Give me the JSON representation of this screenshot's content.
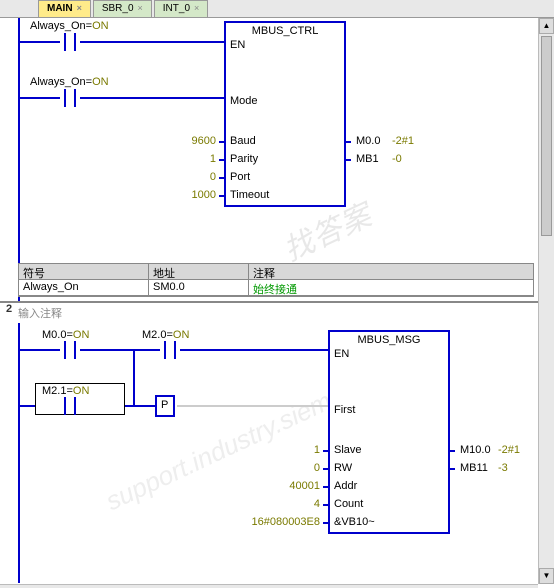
{
  "tabs": {
    "main": "MAIN",
    "sbr0": "SBR_0",
    "int0": "INT_0"
  },
  "net1": {
    "contact1": "Always_On=",
    "contact1_state": "ON",
    "contact2": "Always_On=",
    "contact2_state": "ON",
    "box": {
      "title": "MBUS_CTRL",
      "en": "EN",
      "mode": "Mode",
      "baud_lbl": "Baud",
      "baud_val": "9600",
      "baud_out_addr": "M0.0",
      "baud_out_val": "2#1",
      "parity_lbl": "Parity",
      "parity_val": "1",
      "parity_out_addr": "MB1",
      "parity_out_val": "0",
      "port_lbl": "Port",
      "port_val": "0",
      "timeout_lbl": "Timeout",
      "timeout_val": "1000"
    },
    "table": {
      "h1": "符号",
      "h2": "地址",
      "h3": "注释",
      "r1c1": "Always_On",
      "r1c2": "SM0.0",
      "r1c3": "始终接通"
    }
  },
  "net2": {
    "num": "2",
    "comment": "输入注释",
    "c1": "M0.0=",
    "c1s": "ON",
    "c2": "M2.0=",
    "c2s": "ON",
    "c3": "M2.1=",
    "c3s": "ON",
    "edge": "P",
    "box": {
      "title": "MBUS_MSG",
      "en": "EN",
      "first": "First",
      "slave_lbl": "Slave",
      "slave_val": "1",
      "slave_out_addr": "M10.0",
      "slave_out_val": "2#1",
      "rw_lbl": "RW",
      "rw_val": "0",
      "rw_out_addr": "MB11",
      "rw_out_val": "3",
      "addr_lbl": "Addr",
      "addr_val": "40001",
      "count_lbl": "Count",
      "count_val": "4",
      "dataptr_lbl": "&VB10~",
      "dataptr_val": "16#080003E8"
    }
  },
  "watermark1": "找答案",
  "watermark2": "support.industry.siemens.com/cs"
}
